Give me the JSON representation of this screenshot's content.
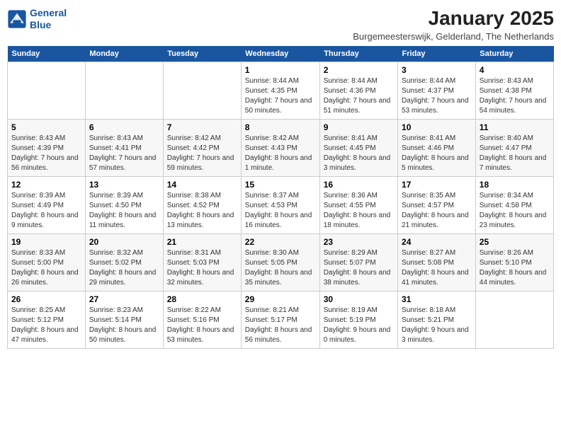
{
  "logo": {
    "line1": "General",
    "line2": "Blue"
  },
  "title": "January 2025",
  "subtitle": "Burgemeesterswijk, Gelderland, The Netherlands",
  "days_of_week": [
    "Sunday",
    "Monday",
    "Tuesday",
    "Wednesday",
    "Thursday",
    "Friday",
    "Saturday"
  ],
  "weeks": [
    [
      {
        "day": "",
        "sunrise": "",
        "sunset": "",
        "daylight": ""
      },
      {
        "day": "",
        "sunrise": "",
        "sunset": "",
        "daylight": ""
      },
      {
        "day": "",
        "sunrise": "",
        "sunset": "",
        "daylight": ""
      },
      {
        "day": "1",
        "sunrise": "Sunrise: 8:44 AM",
        "sunset": "Sunset: 4:35 PM",
        "daylight": "Daylight: 7 hours and 50 minutes."
      },
      {
        "day": "2",
        "sunrise": "Sunrise: 8:44 AM",
        "sunset": "Sunset: 4:36 PM",
        "daylight": "Daylight: 7 hours and 51 minutes."
      },
      {
        "day": "3",
        "sunrise": "Sunrise: 8:44 AM",
        "sunset": "Sunset: 4:37 PM",
        "daylight": "Daylight: 7 hours and 53 minutes."
      },
      {
        "day": "4",
        "sunrise": "Sunrise: 8:43 AM",
        "sunset": "Sunset: 4:38 PM",
        "daylight": "Daylight: 7 hours and 54 minutes."
      }
    ],
    [
      {
        "day": "5",
        "sunrise": "Sunrise: 8:43 AM",
        "sunset": "Sunset: 4:39 PM",
        "daylight": "Daylight: 7 hours and 56 minutes."
      },
      {
        "day": "6",
        "sunrise": "Sunrise: 8:43 AM",
        "sunset": "Sunset: 4:41 PM",
        "daylight": "Daylight: 7 hours and 57 minutes."
      },
      {
        "day": "7",
        "sunrise": "Sunrise: 8:42 AM",
        "sunset": "Sunset: 4:42 PM",
        "daylight": "Daylight: 7 hours and 59 minutes."
      },
      {
        "day": "8",
        "sunrise": "Sunrise: 8:42 AM",
        "sunset": "Sunset: 4:43 PM",
        "daylight": "Daylight: 8 hours and 1 minute."
      },
      {
        "day": "9",
        "sunrise": "Sunrise: 8:41 AM",
        "sunset": "Sunset: 4:45 PM",
        "daylight": "Daylight: 8 hours and 3 minutes."
      },
      {
        "day": "10",
        "sunrise": "Sunrise: 8:41 AM",
        "sunset": "Sunset: 4:46 PM",
        "daylight": "Daylight: 8 hours and 5 minutes."
      },
      {
        "day": "11",
        "sunrise": "Sunrise: 8:40 AM",
        "sunset": "Sunset: 4:47 PM",
        "daylight": "Daylight: 8 hours and 7 minutes."
      }
    ],
    [
      {
        "day": "12",
        "sunrise": "Sunrise: 8:39 AM",
        "sunset": "Sunset: 4:49 PM",
        "daylight": "Daylight: 8 hours and 9 minutes."
      },
      {
        "day": "13",
        "sunrise": "Sunrise: 8:39 AM",
        "sunset": "Sunset: 4:50 PM",
        "daylight": "Daylight: 8 hours and 11 minutes."
      },
      {
        "day": "14",
        "sunrise": "Sunrise: 8:38 AM",
        "sunset": "Sunset: 4:52 PM",
        "daylight": "Daylight: 8 hours and 13 minutes."
      },
      {
        "day": "15",
        "sunrise": "Sunrise: 8:37 AM",
        "sunset": "Sunset: 4:53 PM",
        "daylight": "Daylight: 8 hours and 16 minutes."
      },
      {
        "day": "16",
        "sunrise": "Sunrise: 8:36 AM",
        "sunset": "Sunset: 4:55 PM",
        "daylight": "Daylight: 8 hours and 18 minutes."
      },
      {
        "day": "17",
        "sunrise": "Sunrise: 8:35 AM",
        "sunset": "Sunset: 4:57 PM",
        "daylight": "Daylight: 8 hours and 21 minutes."
      },
      {
        "day": "18",
        "sunrise": "Sunrise: 8:34 AM",
        "sunset": "Sunset: 4:58 PM",
        "daylight": "Daylight: 8 hours and 23 minutes."
      }
    ],
    [
      {
        "day": "19",
        "sunrise": "Sunrise: 8:33 AM",
        "sunset": "Sunset: 5:00 PM",
        "daylight": "Daylight: 8 hours and 26 minutes."
      },
      {
        "day": "20",
        "sunrise": "Sunrise: 8:32 AM",
        "sunset": "Sunset: 5:02 PM",
        "daylight": "Daylight: 8 hours and 29 minutes."
      },
      {
        "day": "21",
        "sunrise": "Sunrise: 8:31 AM",
        "sunset": "Sunset: 5:03 PM",
        "daylight": "Daylight: 8 hours and 32 minutes."
      },
      {
        "day": "22",
        "sunrise": "Sunrise: 8:30 AM",
        "sunset": "Sunset: 5:05 PM",
        "daylight": "Daylight: 8 hours and 35 minutes."
      },
      {
        "day": "23",
        "sunrise": "Sunrise: 8:29 AM",
        "sunset": "Sunset: 5:07 PM",
        "daylight": "Daylight: 8 hours and 38 minutes."
      },
      {
        "day": "24",
        "sunrise": "Sunrise: 8:27 AM",
        "sunset": "Sunset: 5:08 PM",
        "daylight": "Daylight: 8 hours and 41 minutes."
      },
      {
        "day": "25",
        "sunrise": "Sunrise: 8:26 AM",
        "sunset": "Sunset: 5:10 PM",
        "daylight": "Daylight: 8 hours and 44 minutes."
      }
    ],
    [
      {
        "day": "26",
        "sunrise": "Sunrise: 8:25 AM",
        "sunset": "Sunset: 5:12 PM",
        "daylight": "Daylight: 8 hours and 47 minutes."
      },
      {
        "day": "27",
        "sunrise": "Sunrise: 8:23 AM",
        "sunset": "Sunset: 5:14 PM",
        "daylight": "Daylight: 8 hours and 50 minutes."
      },
      {
        "day": "28",
        "sunrise": "Sunrise: 8:22 AM",
        "sunset": "Sunset: 5:16 PM",
        "daylight": "Daylight: 8 hours and 53 minutes."
      },
      {
        "day": "29",
        "sunrise": "Sunrise: 8:21 AM",
        "sunset": "Sunset: 5:17 PM",
        "daylight": "Daylight: 8 hours and 56 minutes."
      },
      {
        "day": "30",
        "sunrise": "Sunrise: 8:19 AM",
        "sunset": "Sunset: 5:19 PM",
        "daylight": "Daylight: 9 hours and 0 minutes."
      },
      {
        "day": "31",
        "sunrise": "Sunrise: 8:18 AM",
        "sunset": "Sunset: 5:21 PM",
        "daylight": "Daylight: 9 hours and 3 minutes."
      },
      {
        "day": "",
        "sunrise": "",
        "sunset": "",
        "daylight": ""
      }
    ]
  ]
}
